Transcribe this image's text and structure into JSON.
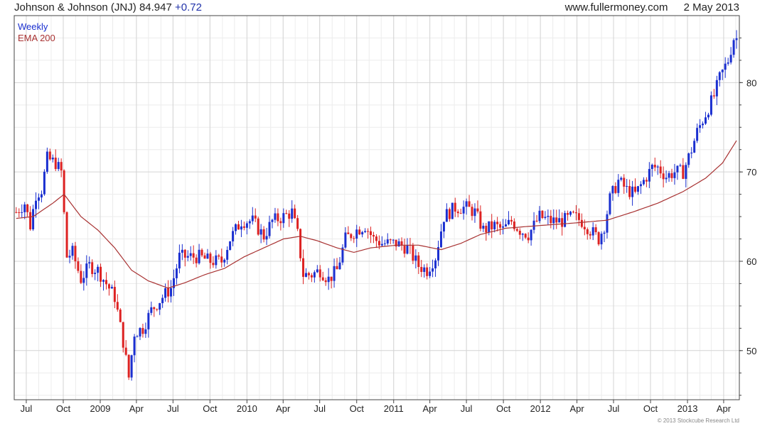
{
  "header": {
    "symbol_title": "Johnson & Johnson (JNJ)",
    "price": "84.947",
    "change": "+0.72",
    "site": "www.fullermoney.com",
    "date": "2 May 2013"
  },
  "credit": "© 2013 Stockcube Research Ltd",
  "colors": {
    "up_candle": "#1a2fd0",
    "down_candle": "#dd2222",
    "ema_line": "#a83232",
    "grid": "#d4d4d4",
    "axis": "#444444"
  },
  "chart_data": {
    "type": "candlestick",
    "title": "Johnson & Johnson (JNJ)",
    "legend": [
      {
        "name": "Weekly",
        "color": "#1a2fd0"
      },
      {
        "name": "EMA 200",
        "color": "#a83232"
      }
    ],
    "legend_position": "top-left",
    "ylim": [
      44.5,
      87.5
    ],
    "yticks": [
      50,
      60,
      70,
      80
    ],
    "xlim": [
      "2008-06-01",
      "2013-05-10"
    ],
    "xticks": [
      {
        "label": "Jul",
        "date": "2008-07-01"
      },
      {
        "label": "Oct",
        "date": "2008-10-01"
      },
      {
        "label": "2009",
        "date": "2009-01-01"
      },
      {
        "label": "Apr",
        "date": "2009-04-01"
      },
      {
        "label": "Jul",
        "date": "2009-07-01"
      },
      {
        "label": "Oct",
        "date": "2009-10-01"
      },
      {
        "label": "2010",
        "date": "2010-01-01"
      },
      {
        "label": "Apr",
        "date": "2010-04-01"
      },
      {
        "label": "Jul",
        "date": "2010-07-01"
      },
      {
        "label": "Oct",
        "date": "2010-10-01"
      },
      {
        "label": "2011",
        "date": "2011-01-01"
      },
      {
        "label": "Apr",
        "date": "2011-04-01"
      },
      {
        "label": "Jul",
        "date": "2011-07-01"
      },
      {
        "label": "Oct",
        "date": "2011-10-01"
      },
      {
        "label": "2012",
        "date": "2012-01-01"
      },
      {
        "label": "Apr",
        "date": "2012-04-01"
      },
      {
        "label": "Jul",
        "date": "2012-07-01"
      },
      {
        "label": "Oct",
        "date": "2012-10-01"
      },
      {
        "label": "2013",
        "date": "2013-01-01"
      },
      {
        "label": "Apr",
        "date": "2013-04-01"
      }
    ],
    "price_anchors": [
      [
        "2008-06-06",
        65.5
      ],
      [
        "2008-06-27",
        66.5
      ],
      [
        "2008-07-11",
        64.0
      ],
      [
        "2008-07-25",
        67.5
      ],
      [
        "2008-08-08",
        68.0
      ],
      [
        "2008-08-22",
        71.5
      ],
      [
        "2008-09-12",
        71.0
      ],
      [
        "2008-09-26",
        70.0
      ],
      [
        "2008-10-10",
        60.5
      ],
      [
        "2008-10-24",
        61.0
      ],
      [
        "2008-11-14",
        58.0
      ],
      [
        "2008-12-05",
        59.5
      ],
      [
        "2008-12-26",
        59.0
      ],
      [
        "2009-01-16",
        57.5
      ],
      [
        "2009-02-06",
        56.0
      ],
      [
        "2009-02-27",
        51.0
      ],
      [
        "2009-03-13",
        47.0
      ],
      [
        "2009-03-27",
        52.0
      ],
      [
        "2009-04-17",
        52.5
      ],
      [
        "2009-05-08",
        54.5
      ],
      [
        "2009-06-05",
        56.0
      ],
      [
        "2009-06-26",
        57.0
      ],
      [
        "2009-07-17",
        60.5
      ],
      [
        "2009-08-07",
        60.5
      ],
      [
        "2009-09-04",
        60.5
      ],
      [
        "2009-10-02",
        60.0
      ],
      [
        "2009-10-30",
        60.0
      ],
      [
        "2009-11-20",
        62.5
      ],
      [
        "2009-12-18",
        64.5
      ],
      [
        "2010-01-15",
        64.5
      ],
      [
        "2010-02-12",
        62.8
      ],
      [
        "2010-03-05",
        64.5
      ],
      [
        "2010-04-02",
        65.0
      ],
      [
        "2010-04-23",
        65.5
      ],
      [
        "2010-05-07",
        63.0
      ],
      [
        "2010-05-21",
        58.5
      ],
      [
        "2010-06-11",
        58.5
      ],
      [
        "2010-07-02",
        59.0
      ],
      [
        "2010-07-23",
        58.0
      ],
      [
        "2010-08-13",
        59.0
      ],
      [
        "2010-09-03",
        62.5
      ],
      [
        "2010-10-01",
        63.5
      ],
      [
        "2010-10-22",
        64.0
      ],
      [
        "2010-11-12",
        62.5
      ],
      [
        "2010-12-03",
        62.0
      ],
      [
        "2011-01-07",
        62.0
      ],
      [
        "2011-02-04",
        61.5
      ],
      [
        "2011-03-04",
        59.5
      ],
      [
        "2011-03-25",
        59.0
      ],
      [
        "2011-04-15",
        60.5
      ],
      [
        "2011-05-06",
        65.0
      ],
      [
        "2011-06-03",
        66.0
      ],
      [
        "2011-07-01",
        66.0
      ],
      [
        "2011-07-22",
        65.5
      ],
      [
        "2011-08-12",
        63.5
      ],
      [
        "2011-09-09",
        64.0
      ],
      [
        "2011-09-30",
        63.5
      ],
      [
        "2011-10-21",
        64.5
      ],
      [
        "2011-11-11",
        63.5
      ],
      [
        "2011-12-02",
        63.0
      ],
      [
        "2011-12-30",
        65.0
      ],
      [
        "2012-01-27",
        64.5
      ],
      [
        "2012-02-24",
        64.5
      ],
      [
        "2012-03-23",
        65.0
      ],
      [
        "2012-04-13",
        64.5
      ],
      [
        "2012-05-04",
        63.5
      ],
      [
        "2012-05-25",
        62.5
      ],
      [
        "2012-06-08",
        64.0
      ],
      [
        "2012-06-22",
        67.0
      ],
      [
        "2012-07-13",
        69.0
      ],
      [
        "2012-08-03",
        68.0
      ],
      [
        "2012-08-24",
        67.5
      ],
      [
        "2012-09-14",
        69.0
      ],
      [
        "2012-10-05",
        70.5
      ],
      [
        "2012-10-19",
        70.5
      ],
      [
        "2012-11-09",
        69.5
      ],
      [
        "2012-11-30",
        70.0
      ],
      [
        "2012-12-21",
        70.0
      ],
      [
        "2013-01-11",
        72.5
      ],
      [
        "2013-01-25",
        74.5
      ],
      [
        "2013-02-15",
        76.5
      ],
      [
        "2013-03-08",
        78.5
      ],
      [
        "2013-03-22",
        80.5
      ],
      [
        "2013-04-12",
        82.5
      ],
      [
        "2013-04-26",
        85.0
      ],
      [
        "2013-05-03",
        84.947
      ]
    ],
    "ema_200": [
      [
        "2008-06-06",
        64.8
      ],
      [
        "2008-07-18",
        65.0
      ],
      [
        "2008-09-05",
        66.5
      ],
      [
        "2008-10-03",
        67.5
      ],
      [
        "2008-11-14",
        65.0
      ],
      [
        "2008-12-26",
        63.5
      ],
      [
        "2009-02-06",
        61.5
      ],
      [
        "2009-03-20",
        59.0
      ],
      [
        "2009-05-01",
        57.8
      ],
      [
        "2009-06-19",
        57.0
      ],
      [
        "2009-07-31",
        57.6
      ],
      [
        "2009-09-18",
        58.5
      ],
      [
        "2009-11-06",
        59.2
      ],
      [
        "2009-12-25",
        60.5
      ],
      [
        "2010-02-12",
        61.5
      ],
      [
        "2010-04-02",
        62.5
      ],
      [
        "2010-05-14",
        62.8
      ],
      [
        "2010-06-25",
        62.3
      ],
      [
        "2010-08-13",
        61.5
      ],
      [
        "2010-09-24",
        61.0
      ],
      [
        "2010-11-05",
        61.5
      ],
      [
        "2011-01-07",
        61.8
      ],
      [
        "2011-03-04",
        61.8
      ],
      [
        "2011-04-29",
        61.3
      ],
      [
        "2011-06-17",
        62.0
      ],
      [
        "2011-08-05",
        63.0
      ],
      [
        "2011-10-07",
        63.7
      ],
      [
        "2011-12-30",
        64.0
      ],
      [
        "2012-03-30",
        64.3
      ],
      [
        "2012-06-15",
        64.6
      ],
      [
        "2012-08-17",
        65.5
      ],
      [
        "2012-10-19",
        66.5
      ],
      [
        "2012-12-21",
        67.8
      ],
      [
        "2013-02-15",
        69.3
      ],
      [
        "2013-03-29",
        71.0
      ],
      [
        "2013-05-03",
        73.5
      ]
    ]
  }
}
